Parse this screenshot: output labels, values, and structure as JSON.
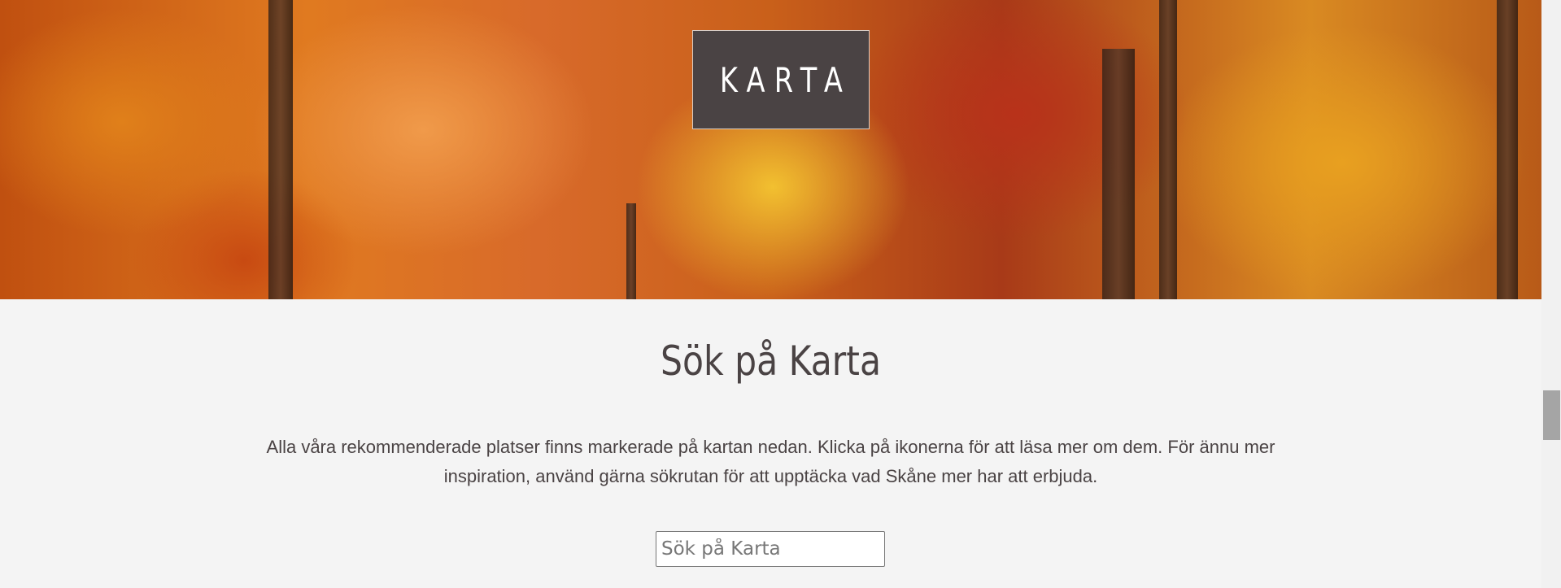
{
  "hero": {
    "title": "KARTA"
  },
  "main": {
    "heading": "Sök på Karta",
    "intro": "Alla våra rekommenderade platser finns markerade på kartan nedan. Klicka på ikonerna för att läsa mer om dem. För ännu mer inspiration, använd gärna sökrutan för att upptäcka vad Skåne mer har att erbjuda.",
    "search_placeholder": "Sök på Karta"
  },
  "scrollbar": {
    "position_fraction": 0.68
  }
}
